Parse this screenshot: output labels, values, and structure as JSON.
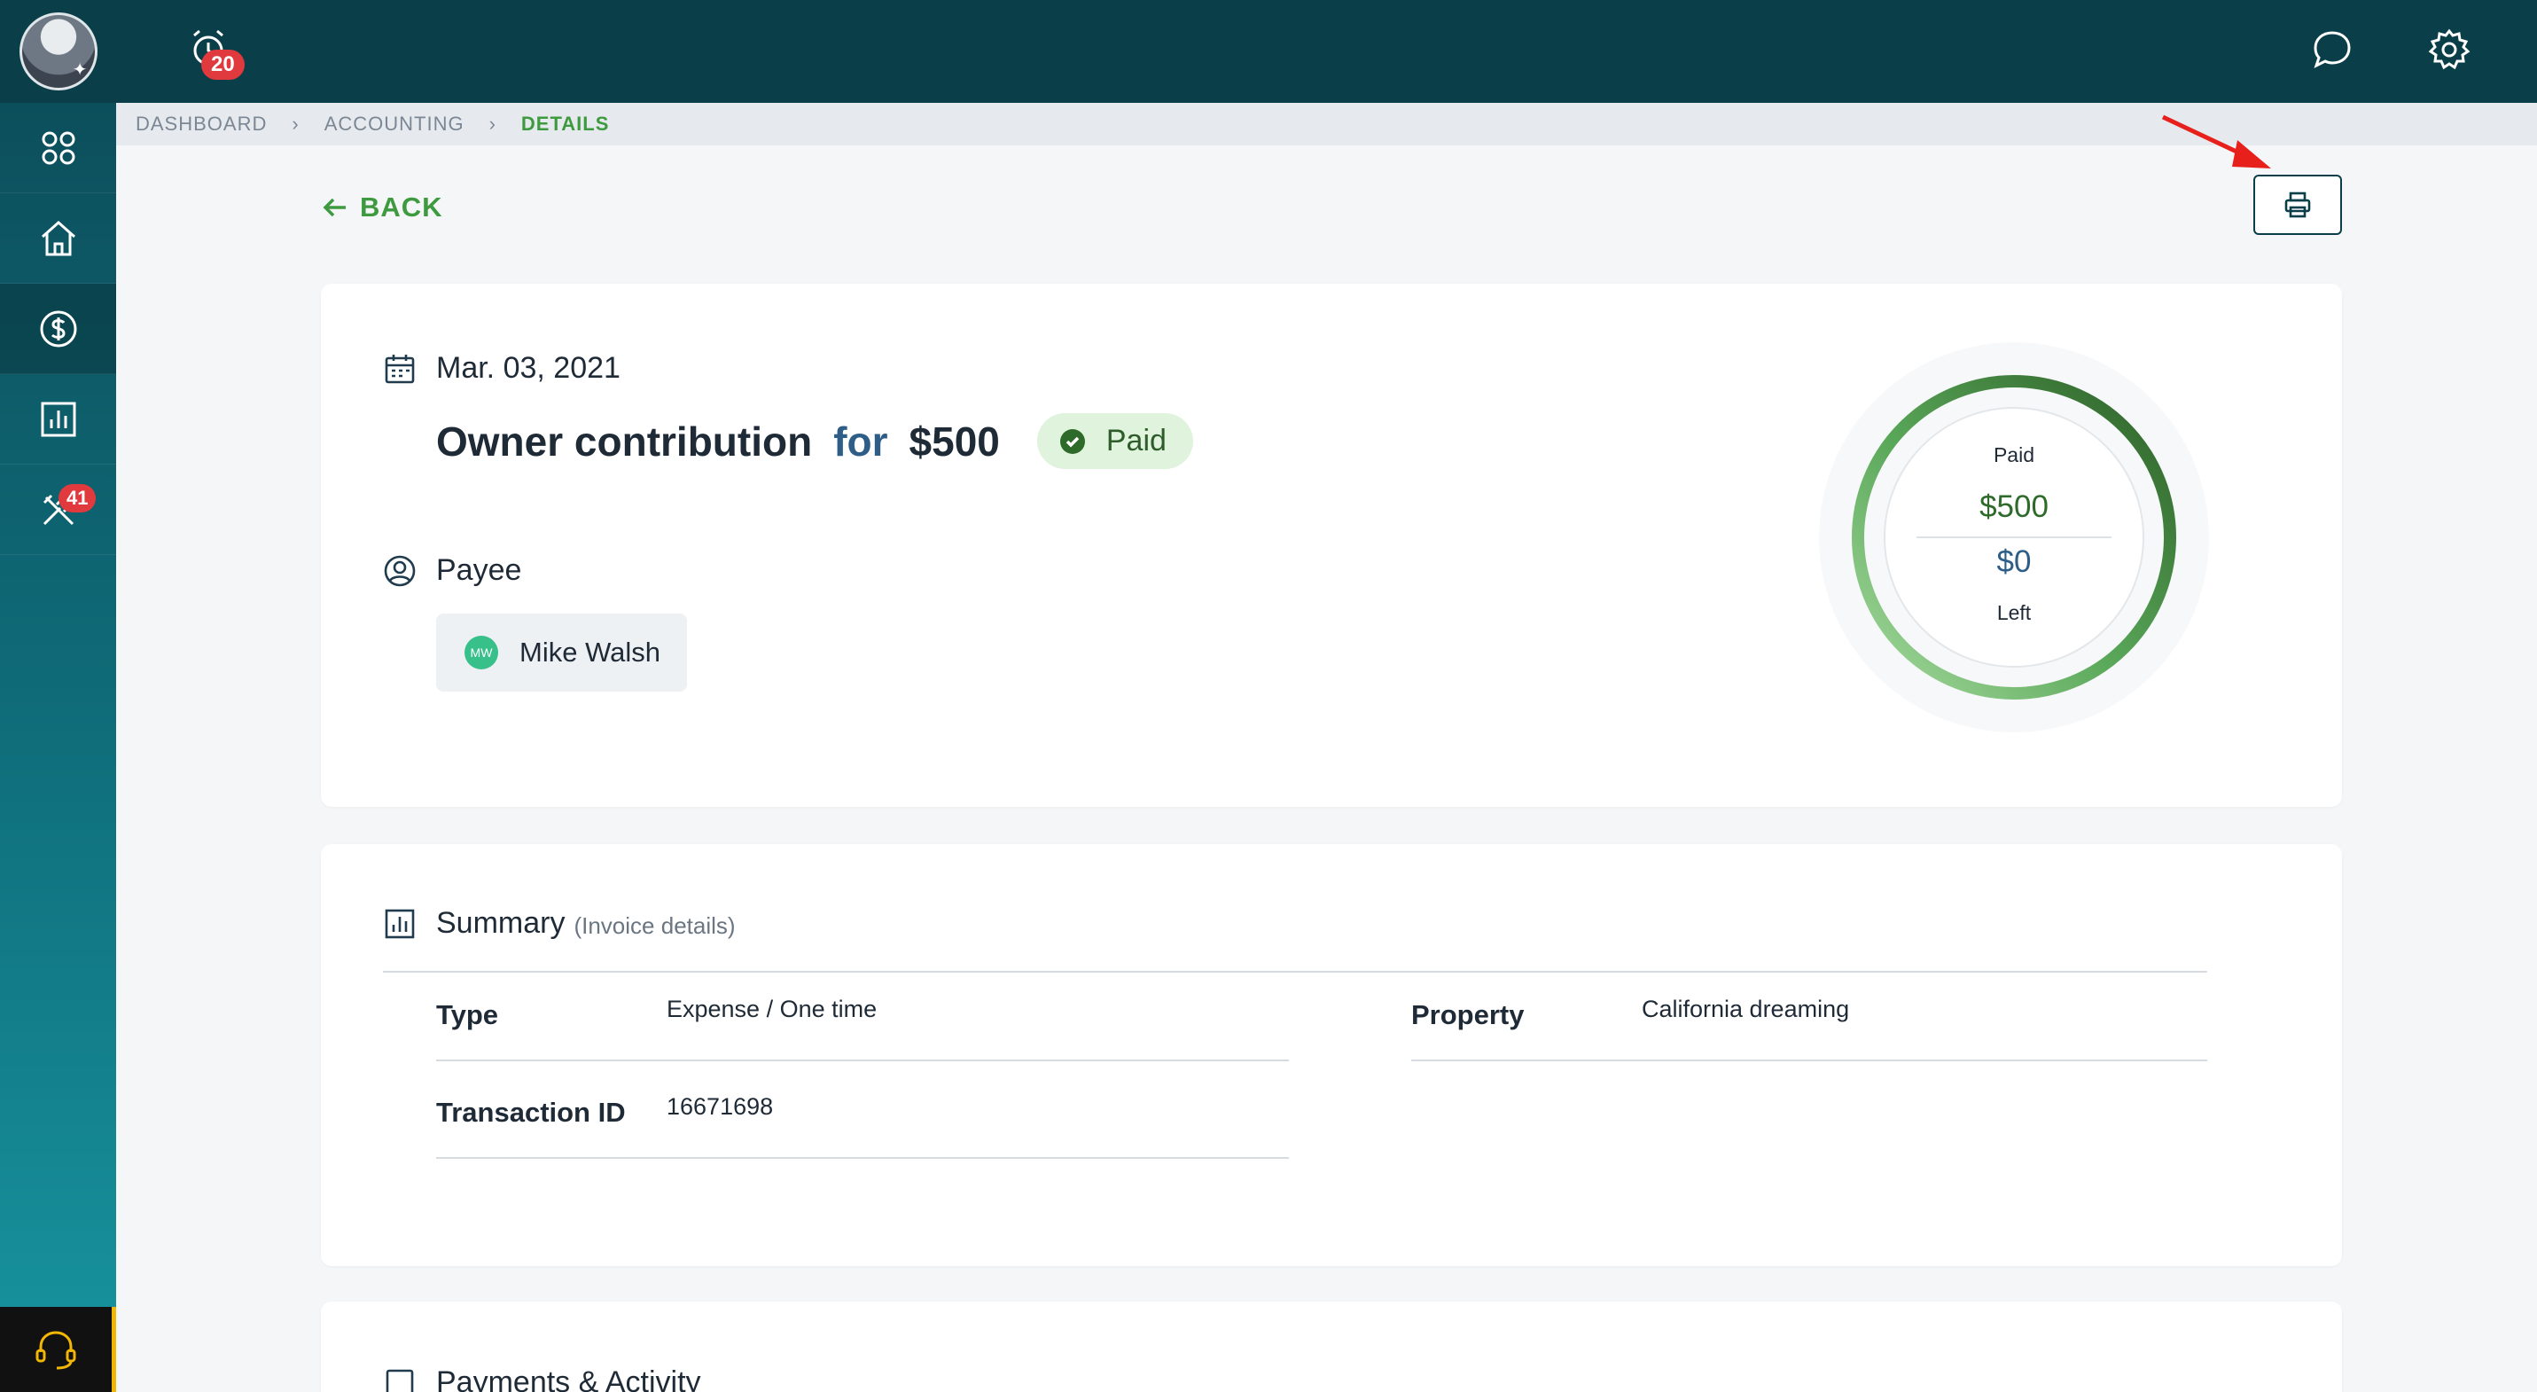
{
  "topbar": {
    "alarm_count": "20"
  },
  "sidebar": {
    "tools_badge": "41"
  },
  "breadcrumb": [
    "DASHBOARD",
    "ACCOUNTING",
    "DETAILS"
  ],
  "back_label": "BACK",
  "transaction": {
    "date": "Mar. 03, 2021",
    "title": "Owner contribution",
    "connector": "for",
    "amount": "$500",
    "status": "Paid",
    "payee_heading": "Payee",
    "payee_initials": "MW",
    "payee_name": "Mike Walsh"
  },
  "gauge": {
    "top_label": "Paid",
    "paid_amount": "$500",
    "left_amount": "$0",
    "bottom_label": "Left",
    "paid_fraction": 1.0
  },
  "summary": {
    "heading": "Summary",
    "subheading": "(Invoice details)",
    "fields": [
      {
        "label": "Type",
        "value": "Expense / One time"
      },
      {
        "label": "Transaction ID",
        "value": "16671698"
      },
      {
        "label": "Property",
        "value": "California dreaming"
      }
    ]
  },
  "payments": {
    "heading": "Payments & Activity"
  },
  "colors": {
    "accent_green": "#3e9a3f",
    "header": "#0a3f4a",
    "badge_red": "#e0393e",
    "support_yellow": "#f2b705"
  }
}
